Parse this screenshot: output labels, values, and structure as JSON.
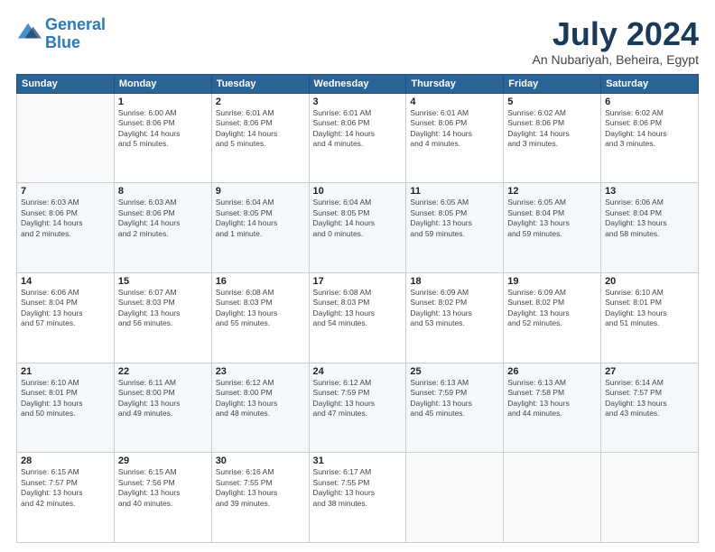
{
  "logo": {
    "line1": "General",
    "line2": "Blue"
  },
  "title": "July 2024",
  "location": "An Nubariyah, Beheira, Egypt",
  "days_header": [
    "Sunday",
    "Monday",
    "Tuesday",
    "Wednesday",
    "Thursday",
    "Friday",
    "Saturday"
  ],
  "weeks": [
    [
      {
        "day": "",
        "info": ""
      },
      {
        "day": "1",
        "info": "Sunrise: 6:00 AM\nSunset: 8:06 PM\nDaylight: 14 hours\nand 5 minutes."
      },
      {
        "day": "2",
        "info": "Sunrise: 6:01 AM\nSunset: 8:06 PM\nDaylight: 14 hours\nand 5 minutes."
      },
      {
        "day": "3",
        "info": "Sunrise: 6:01 AM\nSunset: 8:06 PM\nDaylight: 14 hours\nand 4 minutes."
      },
      {
        "day": "4",
        "info": "Sunrise: 6:01 AM\nSunset: 8:06 PM\nDaylight: 14 hours\nand 4 minutes."
      },
      {
        "day": "5",
        "info": "Sunrise: 6:02 AM\nSunset: 8:06 PM\nDaylight: 14 hours\nand 3 minutes."
      },
      {
        "day": "6",
        "info": "Sunrise: 6:02 AM\nSunset: 8:06 PM\nDaylight: 14 hours\nand 3 minutes."
      }
    ],
    [
      {
        "day": "7",
        "info": "Sunrise: 6:03 AM\nSunset: 8:06 PM\nDaylight: 14 hours\nand 2 minutes."
      },
      {
        "day": "8",
        "info": "Sunrise: 6:03 AM\nSunset: 8:06 PM\nDaylight: 14 hours\nand 2 minutes."
      },
      {
        "day": "9",
        "info": "Sunrise: 6:04 AM\nSunset: 8:05 PM\nDaylight: 14 hours\nand 1 minute."
      },
      {
        "day": "10",
        "info": "Sunrise: 6:04 AM\nSunset: 8:05 PM\nDaylight: 14 hours\nand 0 minutes."
      },
      {
        "day": "11",
        "info": "Sunrise: 6:05 AM\nSunset: 8:05 PM\nDaylight: 13 hours\nand 59 minutes."
      },
      {
        "day": "12",
        "info": "Sunrise: 6:05 AM\nSunset: 8:04 PM\nDaylight: 13 hours\nand 59 minutes."
      },
      {
        "day": "13",
        "info": "Sunrise: 6:06 AM\nSunset: 8:04 PM\nDaylight: 13 hours\nand 58 minutes."
      }
    ],
    [
      {
        "day": "14",
        "info": "Sunrise: 6:06 AM\nSunset: 8:04 PM\nDaylight: 13 hours\nand 57 minutes."
      },
      {
        "day": "15",
        "info": "Sunrise: 6:07 AM\nSunset: 8:03 PM\nDaylight: 13 hours\nand 56 minutes."
      },
      {
        "day": "16",
        "info": "Sunrise: 6:08 AM\nSunset: 8:03 PM\nDaylight: 13 hours\nand 55 minutes."
      },
      {
        "day": "17",
        "info": "Sunrise: 6:08 AM\nSunset: 8:03 PM\nDaylight: 13 hours\nand 54 minutes."
      },
      {
        "day": "18",
        "info": "Sunrise: 6:09 AM\nSunset: 8:02 PM\nDaylight: 13 hours\nand 53 minutes."
      },
      {
        "day": "19",
        "info": "Sunrise: 6:09 AM\nSunset: 8:02 PM\nDaylight: 13 hours\nand 52 minutes."
      },
      {
        "day": "20",
        "info": "Sunrise: 6:10 AM\nSunset: 8:01 PM\nDaylight: 13 hours\nand 51 minutes."
      }
    ],
    [
      {
        "day": "21",
        "info": "Sunrise: 6:10 AM\nSunset: 8:01 PM\nDaylight: 13 hours\nand 50 minutes."
      },
      {
        "day": "22",
        "info": "Sunrise: 6:11 AM\nSunset: 8:00 PM\nDaylight: 13 hours\nand 49 minutes."
      },
      {
        "day": "23",
        "info": "Sunrise: 6:12 AM\nSunset: 8:00 PM\nDaylight: 13 hours\nand 48 minutes."
      },
      {
        "day": "24",
        "info": "Sunrise: 6:12 AM\nSunset: 7:59 PM\nDaylight: 13 hours\nand 47 minutes."
      },
      {
        "day": "25",
        "info": "Sunrise: 6:13 AM\nSunset: 7:59 PM\nDaylight: 13 hours\nand 45 minutes."
      },
      {
        "day": "26",
        "info": "Sunrise: 6:13 AM\nSunset: 7:58 PM\nDaylight: 13 hours\nand 44 minutes."
      },
      {
        "day": "27",
        "info": "Sunrise: 6:14 AM\nSunset: 7:57 PM\nDaylight: 13 hours\nand 43 minutes."
      }
    ],
    [
      {
        "day": "28",
        "info": "Sunrise: 6:15 AM\nSunset: 7:57 PM\nDaylight: 13 hours\nand 42 minutes."
      },
      {
        "day": "29",
        "info": "Sunrise: 6:15 AM\nSunset: 7:56 PM\nDaylight: 13 hours\nand 40 minutes."
      },
      {
        "day": "30",
        "info": "Sunrise: 6:16 AM\nSunset: 7:55 PM\nDaylight: 13 hours\nand 39 minutes."
      },
      {
        "day": "31",
        "info": "Sunrise: 6:17 AM\nSunset: 7:55 PM\nDaylight: 13 hours\nand 38 minutes."
      },
      {
        "day": "",
        "info": ""
      },
      {
        "day": "",
        "info": ""
      },
      {
        "day": "",
        "info": ""
      }
    ]
  ]
}
